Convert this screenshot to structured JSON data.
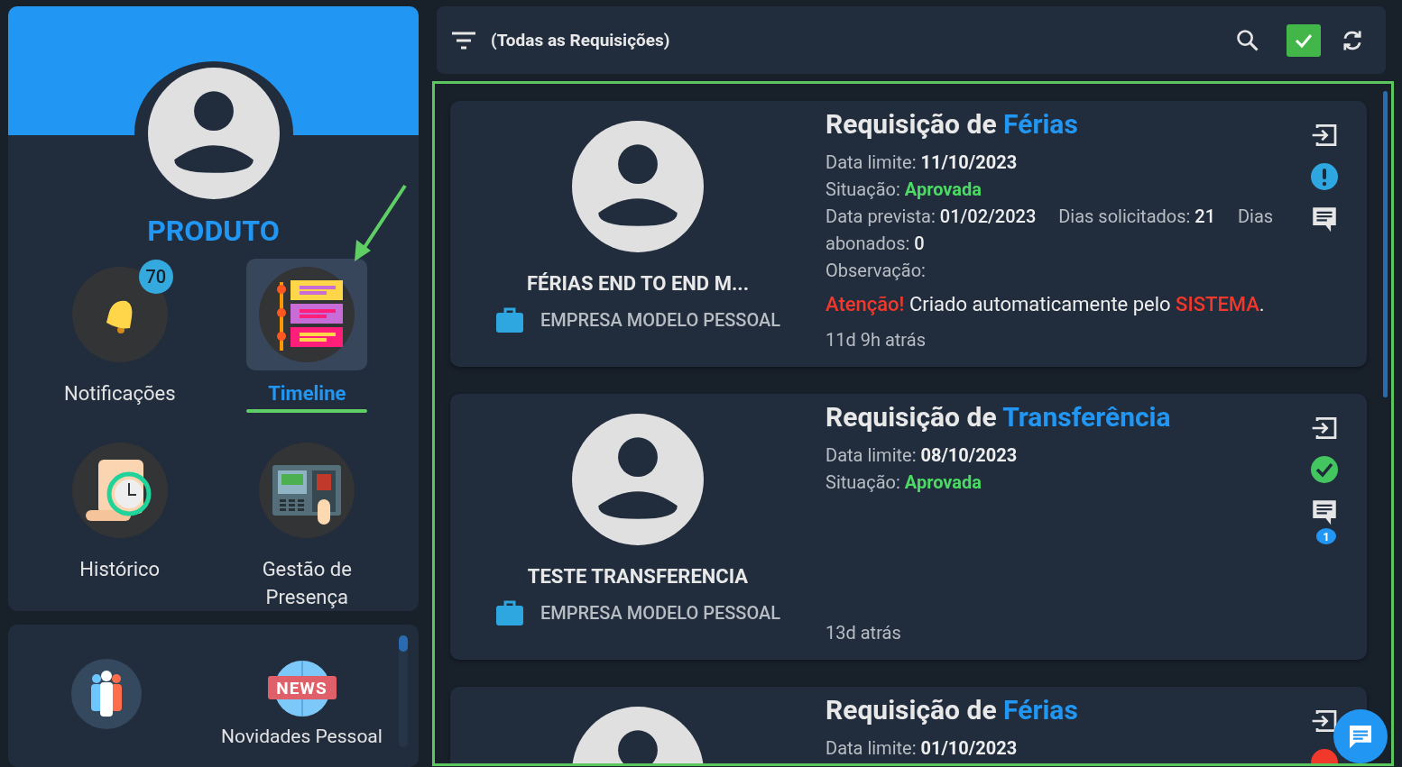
{
  "profile": {
    "name": "PRODUTO"
  },
  "menu": [
    {
      "kind": "bell",
      "label": "Notificações",
      "badge": "70",
      "selected": false
    },
    {
      "kind": "timeline",
      "label": "Timeline",
      "selected": true
    },
    {
      "kind": "history",
      "label": "Histórico",
      "selected": false
    },
    {
      "kind": "attendance",
      "label": "Gestão de Presença",
      "selected": false
    }
  ],
  "shortcuts": [
    {
      "kind": "people"
    },
    {
      "kind": "news",
      "icon_text": "NEWS",
      "label": "Novidades Pessoal"
    }
  ],
  "toolbar": {
    "filter": "(Todas as Requisições)"
  },
  "requests": [
    {
      "title": "Requisição de",
      "type": "Férias",
      "employee": "FÉRIAS END TO END M...",
      "company": "EMPRESA MODELO PESSOAL",
      "limit_label": "Data limite:",
      "limit": "11/10/2023",
      "status_label": "Situação:",
      "status": "Aprovada",
      "details": [
        {
          "label": "Data prevista:",
          "value": "01/02/2023"
        },
        {
          "label": "Dias solicitados:",
          "value": "21"
        },
        {
          "label": "Dias abonados:",
          "value": "0"
        }
      ],
      "observation_label": "Observação:",
      "note": [
        {
          "kind": "alert",
          "text": "Atenção!"
        },
        {
          "kind": "plain",
          "text": " Criado automaticamente pelo "
        },
        {
          "kind": "alert",
          "text": "SISTEMA"
        },
        {
          "kind": "plain",
          "text": "."
        }
      ],
      "time": "11d 9h atrás",
      "kind": "info"
    },
    {
      "title": "Requisição de",
      "type": "Transferência",
      "employee": "TESTE TRANSFERENCIA",
      "company": "EMPRESA MODELO PESSOAL",
      "limit_label": "Data limite:",
      "limit": "08/10/2023",
      "status_label": "Situação:",
      "status": "Aprovada",
      "comments": "1",
      "time": "13d atrás",
      "kind": "approved"
    },
    {
      "title": "Requisição de",
      "type": "Férias",
      "limit_label": "Data limite:",
      "limit": "01/10/2023",
      "kind": "error"
    }
  ]
}
